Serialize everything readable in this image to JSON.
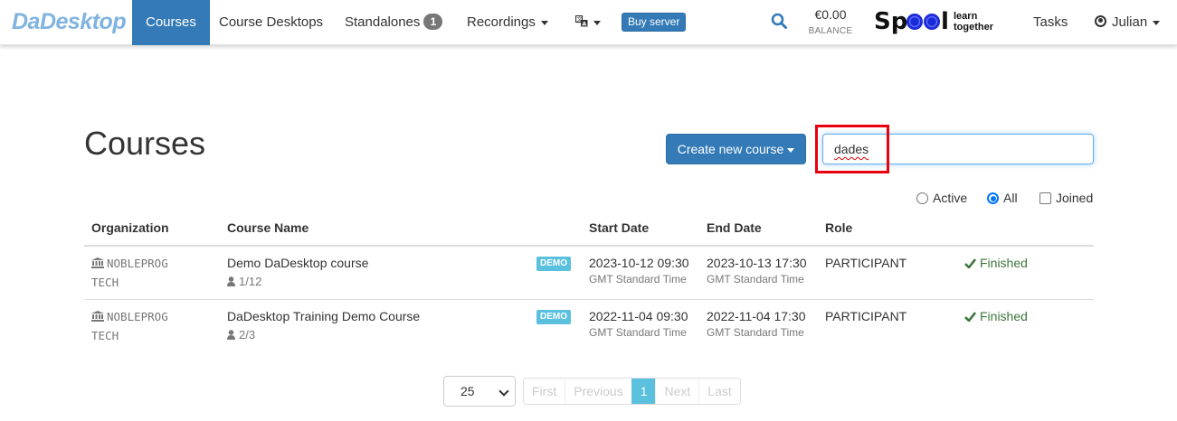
{
  "navbar": {
    "brand": "DaDesktop",
    "items": {
      "courses": "Courses",
      "course_desktops": "Course Desktops",
      "standalones": "Standalones",
      "standalones_badge": "1",
      "recordings": "Recordings",
      "language_icon": "translate-icon"
    },
    "buy_server": "Buy server",
    "balance_amount": "€0.00",
    "balance_label": "BALANCE",
    "spool_word": "Spool",
    "spool_tag_1": "learn",
    "spool_tag_2": "together",
    "tasks": "Tasks",
    "user": "Julian"
  },
  "page": {
    "title": "Courses",
    "create_button": "Create new course",
    "search_value": "dades"
  },
  "filters": {
    "active": "Active",
    "all": "All",
    "joined": "Joined",
    "selected": "All"
  },
  "table": {
    "headers": {
      "organization": "Organization",
      "course_name": "Course Name",
      "start_date": "Start Date",
      "end_date": "End Date",
      "role": "Role"
    },
    "rows": [
      {
        "org_1": "NOBLEPROG",
        "org_2": "TECH",
        "name": "Demo DaDesktop course",
        "count": "1/12",
        "badge": "DEMO",
        "start": "2023-10-12 09:30",
        "start_tz": "GMT Standard Time",
        "end": "2023-10-13 17:30",
        "end_tz": "GMT Standard Time",
        "role": "PARTICIPANT",
        "status": "Finished"
      },
      {
        "org_1": "NOBLEPROG",
        "org_2": "TECH",
        "name": "DaDesktop Training Demo Course",
        "count": "2/3",
        "badge": "DEMO",
        "start": "2022-11-04 09:30",
        "start_tz": "GMT Standard Time",
        "end": "2022-11-04 17:30",
        "end_tz": "GMT Standard Time",
        "role": "PARTICIPANT",
        "status": "Finished"
      }
    ]
  },
  "pagination": {
    "page_size": "25",
    "first": "First",
    "previous": "Previous",
    "current": "1",
    "next": "Next",
    "last": "Last"
  },
  "colors": {
    "primary": "#337ab7",
    "brand": "#7fb3e0",
    "demo_badge": "#5bc0de",
    "finished": "#3c763d",
    "highlight": "#e8000e"
  }
}
